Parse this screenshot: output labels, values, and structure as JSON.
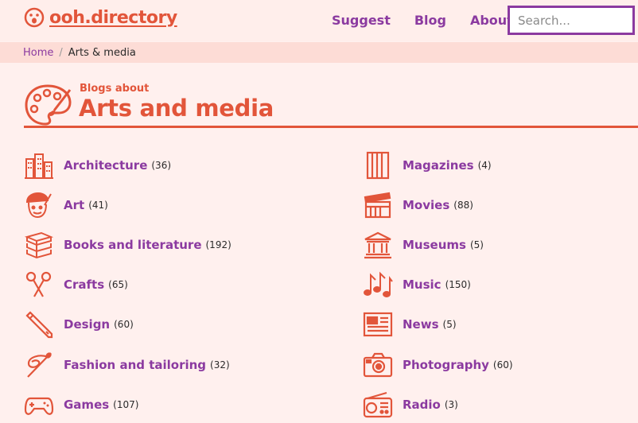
{
  "site": {
    "logo_text": "ooh.directory",
    "nav": [
      "Suggest",
      "Blog",
      "About"
    ],
    "search_placeholder": "Search..."
  },
  "breadcrumb": {
    "home": "Home",
    "sep": "/",
    "current": "Arts & media"
  },
  "page": {
    "subtitle": "Blogs about",
    "title": "Arts and media"
  },
  "categories_left": [
    {
      "name": "Architecture",
      "count": "(36)",
      "icon": "buildings-icon"
    },
    {
      "name": "Art",
      "count": "(41)",
      "icon": "artist-icon"
    },
    {
      "name": "Books and literature",
      "count": "(192)",
      "icon": "books-icon"
    },
    {
      "name": "Crafts",
      "count": "(65)",
      "icon": "scissors-icon"
    },
    {
      "name": "Design",
      "count": "(60)",
      "icon": "pencil-icon"
    },
    {
      "name": "Fashion and tailoring",
      "count": "(32)",
      "icon": "needle-thread-icon"
    },
    {
      "name": "Games",
      "count": "(107)",
      "icon": "gamepad-icon"
    }
  ],
  "categories_right": [
    {
      "name": "Magazines",
      "count": "(4)",
      "icon": "magazine-icon"
    },
    {
      "name": "Movies",
      "count": "(88)",
      "icon": "clapperboard-icon"
    },
    {
      "name": "Museums",
      "count": "(5)",
      "icon": "museum-icon"
    },
    {
      "name": "Music",
      "count": "(150)",
      "icon": "music-notes-icon"
    },
    {
      "name": "News",
      "count": "(5)",
      "icon": "newspaper-icon"
    },
    {
      "name": "Photography",
      "count": "(60)",
      "icon": "camera-icon"
    },
    {
      "name": "Radio",
      "count": "(3)",
      "icon": "radio-icon"
    }
  ],
  "colors": {
    "accent": "#e2553a",
    "link": "#8b3aa0",
    "background": "#fff0ee",
    "breadcrumb_bg": "#fddcd6"
  }
}
